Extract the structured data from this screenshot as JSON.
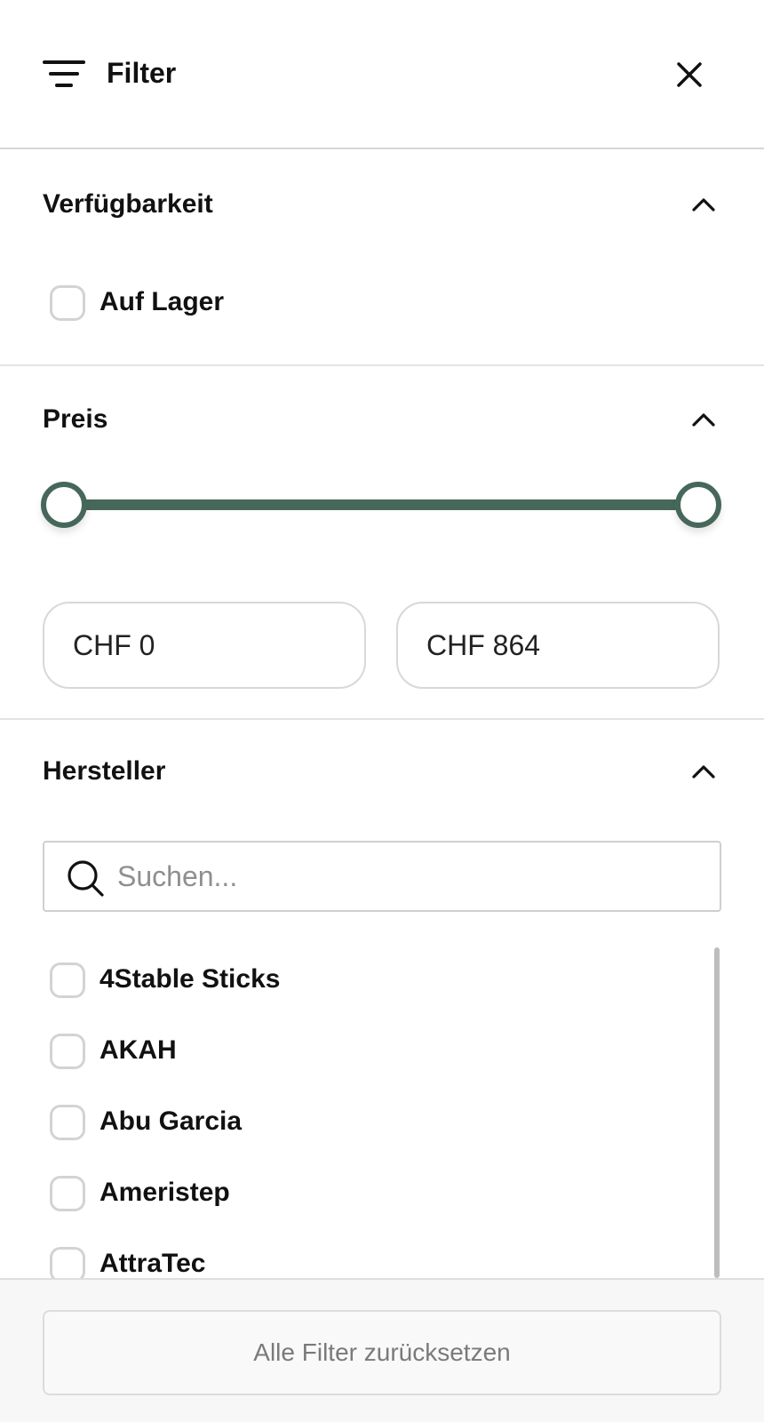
{
  "header": {
    "title": "Filter",
    "filter_icon": "filter-lines-icon",
    "close_icon": "close-icon"
  },
  "availability": {
    "title": "Verfügbarkeit",
    "options": [
      {
        "label": "Auf Lager",
        "checked": false
      }
    ]
  },
  "price": {
    "title": "Preis",
    "min_value": "CHF 0",
    "max_value": "CHF 864",
    "slider_low_fraction": 0,
    "slider_high_fraction": 1
  },
  "manufacturer": {
    "title": "Hersteller",
    "search": {
      "placeholder": "Suchen...",
      "value": ""
    },
    "items": [
      {
        "label": "4Stable Sticks",
        "checked": false
      },
      {
        "label": "AKAH",
        "checked": false
      },
      {
        "label": "Abu Garcia",
        "checked": false
      },
      {
        "label": "Ameristep",
        "checked": false
      },
      {
        "label": "AttraTec",
        "checked": false
      }
    ]
  },
  "footer": {
    "reset_label": "Alle Filter zurücksetzen"
  },
  "colors": {
    "accent": "#46685a",
    "border": "#d6d6d6",
    "footer_bg": "#f7f7f7"
  }
}
